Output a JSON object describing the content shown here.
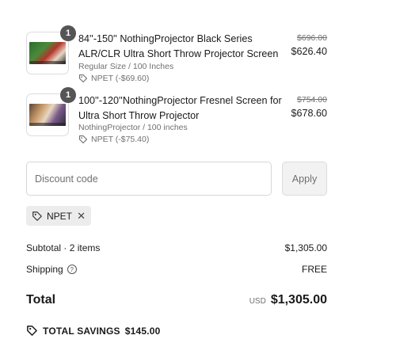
{
  "items": [
    {
      "quantity": "1",
      "title": "84''-150'' NothingProjector Black Series ALR/CLR Ultra Short Throw Projector Screen",
      "variant": "Regular Size / 100 Inches",
      "discount": "NPET (-$69.60)",
      "original_price": "$696.00",
      "price": "$626.40"
    },
    {
      "quantity": "1",
      "title": "100''-120''NothingProjector Fresnel Screen for Ultra Short Throw Projector",
      "variant": "NothingProjector / 100 inches",
      "discount": "NPET (-$75.40)",
      "original_price": "$754.00",
      "price": "$678.60"
    }
  ],
  "discount_form": {
    "placeholder": "Discount code",
    "apply_label": "Apply"
  },
  "applied_code": "NPET",
  "summary": {
    "subtotal_label": "Subtotal · 2 items",
    "subtotal_value": "$1,305.00",
    "shipping_label": "Shipping",
    "shipping_value": "FREE",
    "total_label": "Total",
    "currency": "USD",
    "total_value": "$1,305.00",
    "savings_label": "TOTAL SAVINGS",
    "savings_value": "$145.00"
  }
}
